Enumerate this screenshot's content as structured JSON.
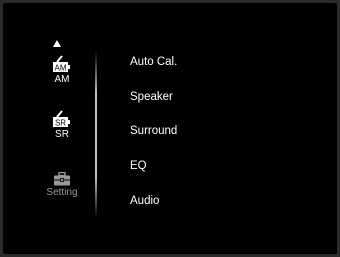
{
  "sidebar": {
    "items": [
      {
        "icon": "am-preset-icon",
        "badge": "AM",
        "label": "AM"
      },
      {
        "icon": "sr-preset-icon",
        "badge": "SR",
        "label": "SR"
      },
      {
        "icon": "toolbox-icon",
        "label": "Setting"
      }
    ]
  },
  "menu": {
    "items": [
      {
        "label": "Auto Cal."
      },
      {
        "label": "Speaker"
      },
      {
        "label": "Surround"
      },
      {
        "label": "EQ"
      },
      {
        "label": "Audio"
      }
    ]
  },
  "colors": {
    "background": "#000000",
    "text": "#ffffff",
    "dim_text": "#9a9a9a"
  }
}
